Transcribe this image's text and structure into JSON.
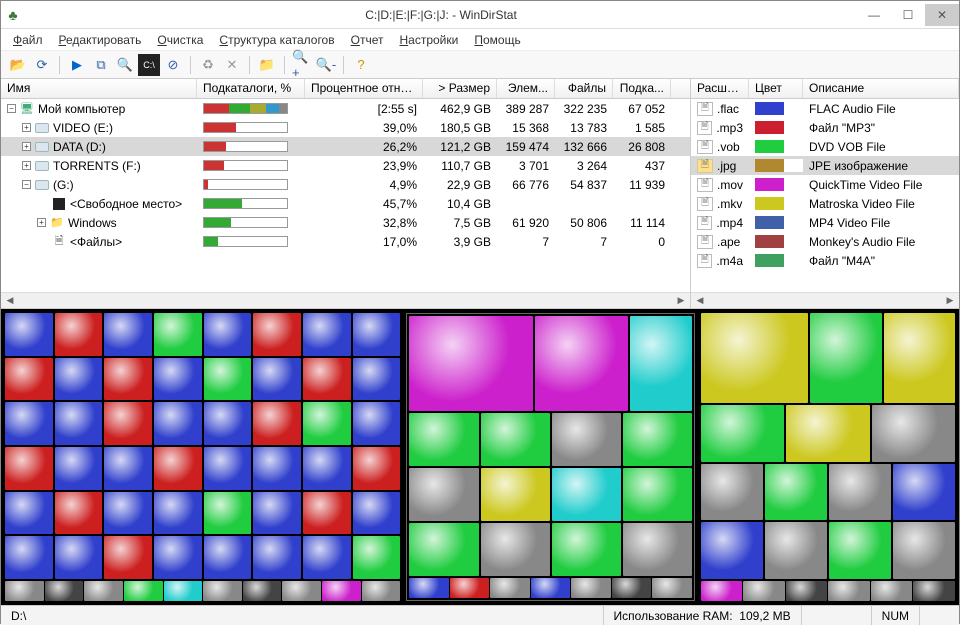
{
  "window": {
    "title": "C:|D:|E:|F:|G:|J: - WinDirStat"
  },
  "menu": {
    "items": [
      "Файл",
      "Редактировать",
      "Очистка",
      "Структура каталогов",
      "Отчет",
      "Настройки",
      "Помощь"
    ]
  },
  "toolbar": {
    "icons": [
      "open",
      "refresh",
      "play",
      "copy",
      "explorer",
      "cmd",
      "delete",
      "recycle",
      "cancel",
      "folder",
      "zoomin",
      "zoomout",
      "help"
    ]
  },
  "tree": {
    "headers": [
      "Имя",
      "Подкаталоги, %",
      "Процентное отно...",
      "> Размер",
      "Элем...",
      "Файлы",
      "Подка..."
    ],
    "rows": [
      {
        "depth": 0,
        "exp": "-",
        "icon": "comp",
        "name": "Мой компьютер",
        "pct_fill": 100,
        "pct_colors": [
          "#c33",
          "#3a3",
          "#aa3",
          "#39c",
          "#888"
        ],
        "pct_text": "[2:55 s]",
        "size": "462,9 GB",
        "items": "389 287",
        "files": "322 235",
        "sub": "67 052",
        "selected": false
      },
      {
        "depth": 1,
        "exp": "+",
        "icon": "drive",
        "name": "VIDEO (E:)",
        "pct_fill": 39,
        "pct_colors": [
          "#c33"
        ],
        "pct_text": "39,0%",
        "size": "180,5 GB",
        "items": "15 368",
        "files": "13 783",
        "sub": "1 585",
        "selected": false
      },
      {
        "depth": 1,
        "exp": "+",
        "icon": "drive",
        "name": "DATA (D:)",
        "pct_fill": 26,
        "pct_colors": [
          "#c33"
        ],
        "pct_text": "26,2%",
        "size": "121,2 GB",
        "items": "159 474",
        "files": "132 666",
        "sub": "26 808",
        "selected": true
      },
      {
        "depth": 1,
        "exp": "+",
        "icon": "drive",
        "name": "TORRENTS (F:)",
        "pct_fill": 24,
        "pct_colors": [
          "#c33"
        ],
        "pct_text": "23,9%",
        "size": "110,7 GB",
        "items": "3 701",
        "files": "3 264",
        "sub": "437",
        "selected": false
      },
      {
        "depth": 1,
        "exp": "-",
        "icon": "drive",
        "name": "(G:)",
        "pct_fill": 5,
        "pct_colors": [
          "#c33"
        ],
        "pct_text": "4,9%",
        "size": "22,9 GB",
        "items": "66 776",
        "files": "54 837",
        "sub": "11 939",
        "selected": false
      },
      {
        "depth": 2,
        "exp": "",
        "icon": "freespace",
        "name": "<Свободное место>",
        "pct_fill": 46,
        "pct_colors": [
          "#3a3"
        ],
        "pct_text": "45,7%",
        "size": "10,4 GB",
        "items": "",
        "files": "",
        "sub": "",
        "selected": false
      },
      {
        "depth": 2,
        "exp": "+",
        "icon": "folder",
        "name": "Windows",
        "pct_fill": 33,
        "pct_colors": [
          "#3a3"
        ],
        "pct_text": "32,8%",
        "size": "7,5 GB",
        "items": "61 920",
        "files": "50 806",
        "sub": "11 114",
        "selected": false
      },
      {
        "depth": 2,
        "exp": "",
        "icon": "files",
        "name": "<Файлы>",
        "pct_fill": 17,
        "pct_colors": [
          "#3a3"
        ],
        "pct_text": "17,0%",
        "size": "3,9 GB",
        "items": "7",
        "files": "7",
        "sub": "0",
        "selected": false
      }
    ]
  },
  "ext": {
    "headers": [
      "Расши...",
      "Цвет",
      "Описание"
    ],
    "rows": [
      {
        "icon": "",
        "ext": ".flac",
        "color": "#3040cc",
        "desc": "FLAC Audio File",
        "selected": false
      },
      {
        "icon": "",
        "ext": ".mp3",
        "color": "#cc2030",
        "desc": "Файл \"MP3\"",
        "selected": false
      },
      {
        "icon": "",
        "ext": ".vob",
        "color": "#20cc40",
        "desc": "DVD VOB File",
        "selected": false
      },
      {
        "icon": "jpg",
        "ext": ".jpg",
        "color": "#b08830",
        "desc": "JPE изображение",
        "selected": true
      },
      {
        "icon": "",
        "ext": ".mov",
        "color": "#cc20cc",
        "desc": "QuickTime Video File",
        "selected": false
      },
      {
        "icon": "",
        "ext": ".mkv",
        "color": "#ccc820",
        "desc": "Matroska Video File",
        "selected": false
      },
      {
        "icon": "",
        "ext": ".mp4",
        "color": "#4060aa",
        "desc": "MP4 Video File",
        "selected": false
      },
      {
        "icon": "",
        "ext": ".ape",
        "color": "#a04040",
        "desc": "Monkey's Audio File",
        "selected": false
      },
      {
        "icon": "",
        "ext": ".m4a",
        "color": "#40a060",
        "desc": "Файл \"M4A\"",
        "selected": false
      }
    ]
  },
  "status": {
    "path": "D:\\",
    "ram_label": "Использование RAM:",
    "ram_value": "109,2 MB",
    "num": "NUM"
  }
}
